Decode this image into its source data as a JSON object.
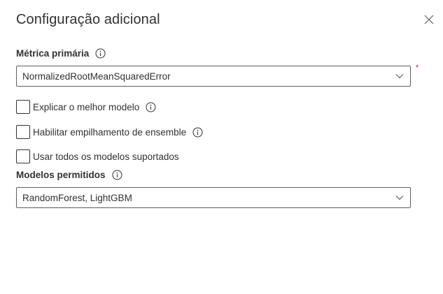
{
  "panel": {
    "title": "Configuração adicional"
  },
  "primary_metric": {
    "label": "Métrica primária",
    "value": "NormalizedRootMeanSquaredError",
    "required_marker": "*"
  },
  "checkboxes": [
    {
      "label": "Explicar o melhor modelo",
      "checked": false,
      "has_info": true
    },
    {
      "label": "Habilitar empilhamento de ensemble",
      "checked": false,
      "has_info": true
    },
    {
      "label": "Usar todos os modelos suportados",
      "checked": false,
      "has_info": false
    }
  ],
  "allowed_models": {
    "label": "Modelos permitidos",
    "value": "RandomForest, LightGBM"
  },
  "icons": {
    "close": "close-icon",
    "info": "info-icon",
    "chevron": "chevron-down-icon"
  },
  "colors": {
    "text": "#323130",
    "border": "#605e5c",
    "required": "#a4262c"
  }
}
